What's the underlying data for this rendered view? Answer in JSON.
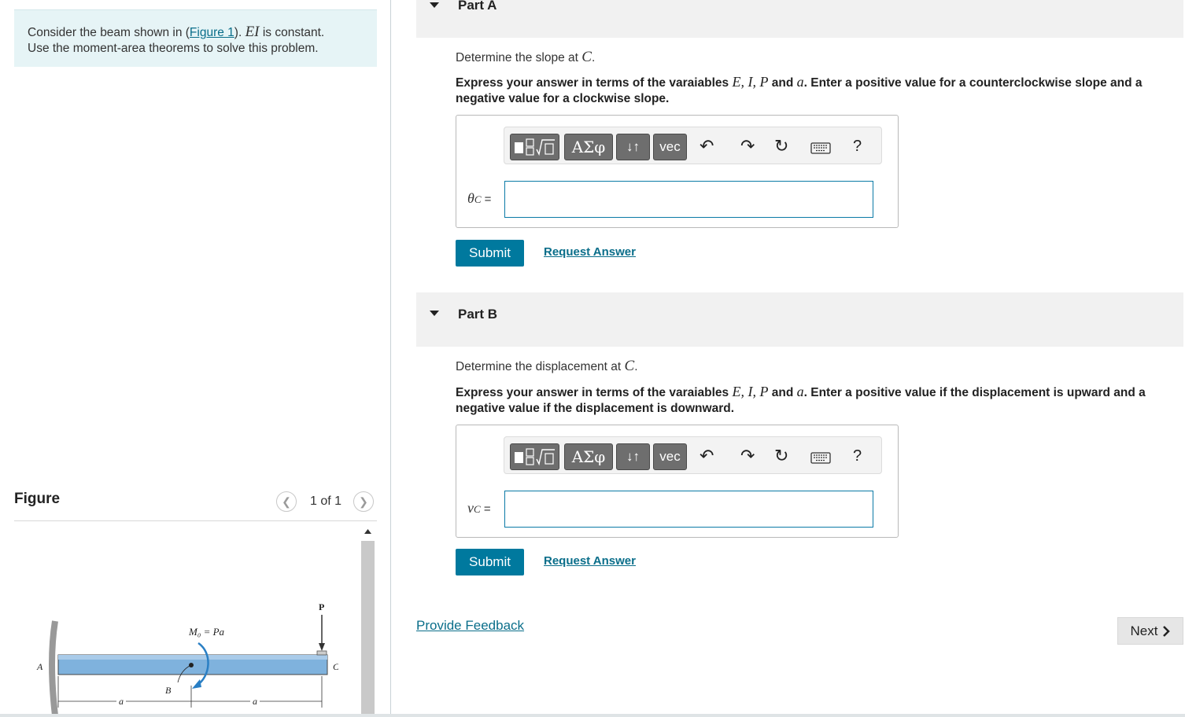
{
  "intro": {
    "text_before_link": "Consider the beam shown in (",
    "link": "Figure 1",
    "text_after_link": "). ",
    "ei": "EI",
    "constant": " is constant.",
    "line2": "Use the moment-area theorems to solve this problem."
  },
  "toolbar": {
    "greek": "ΑΣφ",
    "arrows": "↓↑",
    "vec": "vec",
    "help": "?",
    "icons": [
      "templates-icon",
      "undo-icon",
      "redo-icon",
      "reset-icon",
      "keyboard-icon",
      "help-icon"
    ]
  },
  "partA": {
    "title": "Part A",
    "prompt_text": "Determine the slope at ",
    "prompt_var": "C",
    "instr_1": "Express your answer in terms of the varaiables ",
    "instr_vars": "E, I, P",
    "instr_and": " and ",
    "instr_a": "a",
    "instr_2": ". Enter a positive value for a counterclockwise slope and a negative value for a clockwise slope.",
    "label_sym": "θ",
    "label_sub": "C",
    "label_eq": " =",
    "input_value": "",
    "submit": "Submit",
    "request": "Request Answer"
  },
  "partB": {
    "title": "Part B",
    "prompt_text": "Determine the displacement at ",
    "prompt_var": "C",
    "instr_1": "Express your answer in terms of the varaiables ",
    "instr_vars": "E, I, P",
    "instr_and": " and ",
    "instr_a": "a",
    "instr_2": ". Enter a positive value if the displacement is upward and a negative value if the displacement is downward.",
    "label_sym": "v",
    "label_sub": "C",
    "label_eq": " =",
    "input_value": "",
    "submit": "Submit",
    "request": "Request Answer"
  },
  "feedback": "Provide Feedback",
  "next": "Next",
  "figure": {
    "title": "Figure",
    "pager": "1 of 1",
    "labels": {
      "A": "A",
      "B": "B",
      "C": "C",
      "P": "P",
      "moment": "M₀ = Pa",
      "a1": "a",
      "a2": "a"
    }
  },
  "colors": {
    "accent": "#00799e",
    "link": "#0a6e8a",
    "intro_bg": "#e6f4f6",
    "beam": "#7fb2dd"
  }
}
